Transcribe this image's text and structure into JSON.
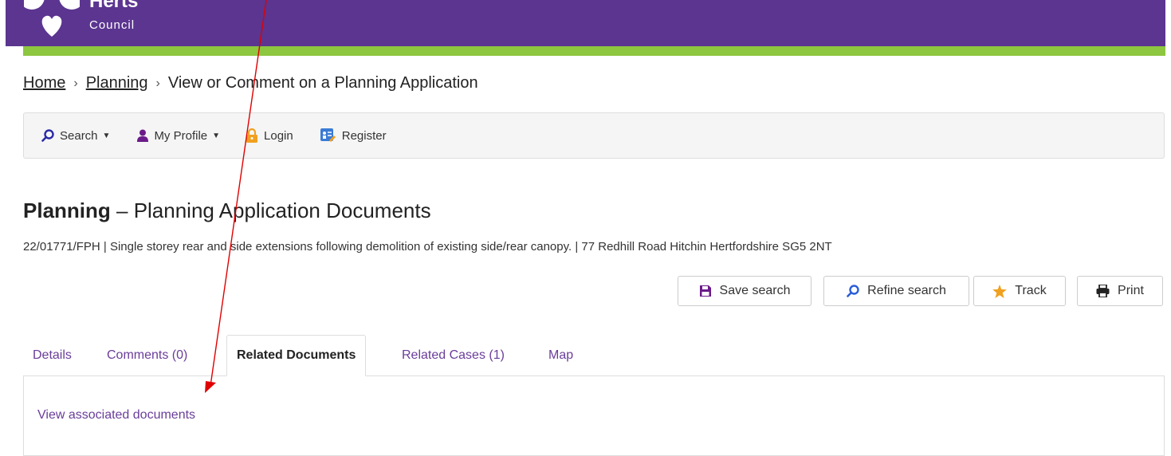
{
  "header": {
    "brand_line1": "Herts",
    "brand_line2": "Council",
    "colors": {
      "primary": "#5b3590",
      "accent": "#8dc63f"
    }
  },
  "breadcrumb": {
    "home": "Home",
    "planning": "Planning",
    "current": "View or Comment on a Planning Application",
    "separator": "›"
  },
  "navbar": {
    "search": "Search",
    "my_profile": "My Profile",
    "login": "Login",
    "register": "Register"
  },
  "page": {
    "title_bold": "Planning",
    "title_rest": " – Planning Application Documents",
    "summary": "22/01771/FPH | Single storey rear and side extensions following demolition of existing side/rear canopy. | 77 Redhill Road Hitchin Hertfordshire SG5 2NT"
  },
  "actions": {
    "save_search": "Save search",
    "refine_search": "Refine search",
    "track": "Track",
    "print": "Print"
  },
  "tabs": {
    "details": "Details",
    "comments": "Comments (0)",
    "related_documents": "Related Documents",
    "related_cases": "Related Cases (1)",
    "map": "Map",
    "active": "Related Documents"
  },
  "panel": {
    "link": "View associated documents"
  }
}
